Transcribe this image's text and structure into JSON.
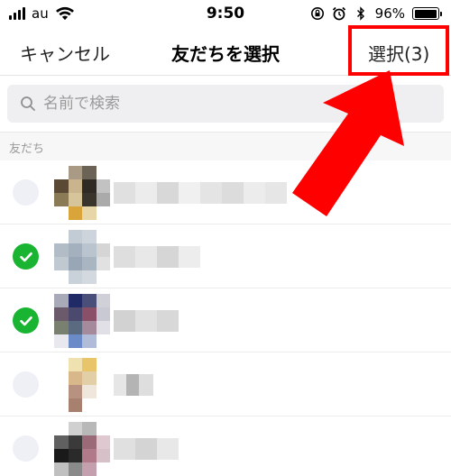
{
  "status_bar": {
    "carrier": "au",
    "time": "9:50",
    "battery_percent": "96%",
    "battery_level": 0.96
  },
  "nav": {
    "cancel_label": "キャンセル",
    "title": "友だちを選択",
    "select_label": "選択(3)"
  },
  "search": {
    "placeholder": "名前で検索",
    "value": ""
  },
  "section": {
    "label": "友だち"
  },
  "friends": [
    {
      "selected": false
    },
    {
      "selected": true
    },
    {
      "selected": true
    },
    {
      "selected": false
    },
    {
      "selected": false
    }
  ],
  "colors": {
    "check_green": "#19b431",
    "highlight_red": "#ff0000",
    "unchecked_circle": "#eef0f6"
  },
  "icons": [
    "signal-icon",
    "wifi-icon",
    "orientation-lock-icon",
    "alarm-icon",
    "bluetooth-icon",
    "battery-icon",
    "search-icon",
    "checkmark-icon"
  ]
}
